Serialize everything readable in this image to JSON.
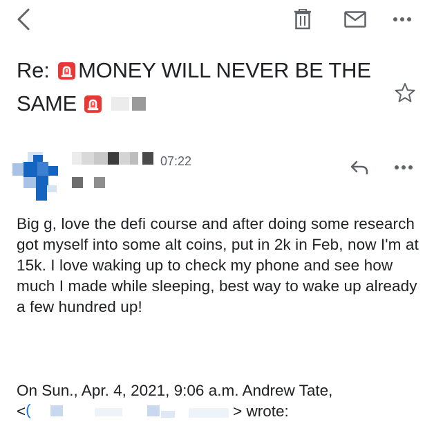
{
  "toolbar": {
    "back_icon": "chevron-left-icon",
    "delete_icon": "trash-icon",
    "mark_unread_icon": "envelope-icon",
    "more_icon": "more-horizontal-icon"
  },
  "email": {
    "subject_prefix": "Re: ",
    "subject_middle": "MONEY WILL NEVER BE THE SAME",
    "subject_emoji_icon": "police-siren-emoji",
    "star_icon": "star-outline-icon"
  },
  "message": {
    "time": "07:22",
    "reply_icon": "reply-icon",
    "more_icon": "more-horizontal-icon",
    "body": "Big g, love the defi course and after doing some research got myself into some alt coins, put in 2k in Feb, now I'm at 15k. I love waking up to check my phone and see how much I made while sleeping, best way to wake up already a few hundred up!"
  },
  "quote": {
    "line1": "On Sun., Apr. 4, 2021, 9:06 a.m. Andrew Tate,",
    "open": "<",
    "email_first_char": "(",
    "close": "> wrote:"
  },
  "colors": {
    "text": "#202124",
    "secondary": "#5f6368",
    "avatar_blue": "#1565c0",
    "link_blue": "#1a73e8",
    "siren_red": "#e53935"
  }
}
